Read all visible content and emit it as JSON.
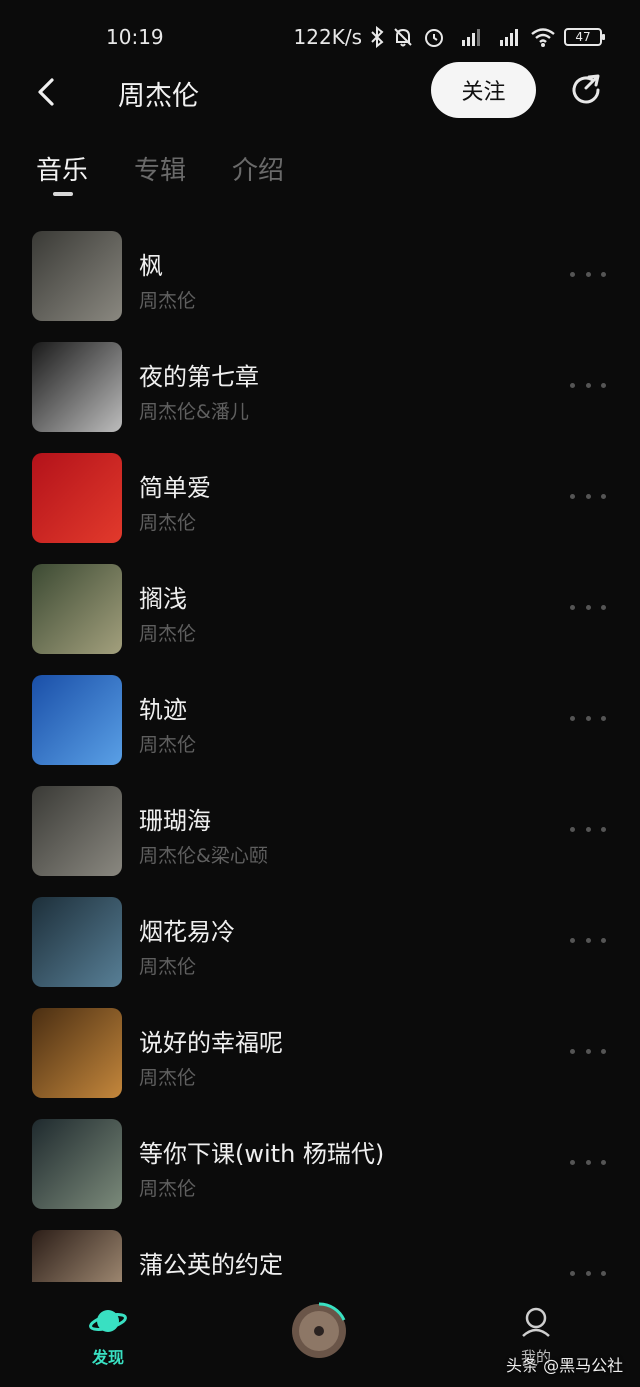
{
  "status_bar": {
    "time": "10:19",
    "speed": "122K/s",
    "battery": "47",
    "icons": [
      "bluetooth-icon",
      "bell-off-icon",
      "alarm-icon",
      "signal-hd-icon",
      "signal-hd-icon",
      "wifi-icon",
      "battery-icon"
    ]
  },
  "header": {
    "title": "周杰伦",
    "follow_label": "关注",
    "back_icon": "back-arrow-icon",
    "share_icon": "share-icon"
  },
  "tabs": [
    {
      "label": "音乐",
      "active": true
    },
    {
      "label": "专辑",
      "active": false
    },
    {
      "label": "介绍",
      "active": false
    }
  ],
  "songs": [
    {
      "title": "枫",
      "artist": "周杰伦",
      "cover": [
        "#3a3a36",
        "#8a8880"
      ]
    },
    {
      "title": "夜的第七章",
      "artist": "周杰伦&潘儿",
      "cover": [
        "#1a1a1a",
        "#bdbdbd"
      ]
    },
    {
      "title": "简单爱",
      "artist": "周杰伦",
      "cover": [
        "#b3121a",
        "#e23a2c"
      ]
    },
    {
      "title": "搁浅",
      "artist": "周杰伦",
      "cover": [
        "#3c4a33",
        "#a3a07d"
      ]
    },
    {
      "title": "轨迹",
      "artist": "周杰伦",
      "cover": [
        "#1a4fa8",
        "#5aa0e6"
      ]
    },
    {
      "title": "珊瑚海",
      "artist": "周杰伦&梁心颐",
      "cover": [
        "#3a3a36",
        "#8a8880"
      ]
    },
    {
      "title": "烟花易冷",
      "artist": "周杰伦",
      "cover": [
        "#1d2f3a",
        "#587f96"
      ]
    },
    {
      "title": "说好的幸福呢",
      "artist": "周杰伦",
      "cover": [
        "#4a2e12",
        "#c4873c"
      ]
    },
    {
      "title": "等你下课(with 杨瑞代)",
      "artist": "周杰伦",
      "cover": [
        "#1f2a2e",
        "#7b8a7a"
      ]
    },
    {
      "title": "蒲公英的约定",
      "artist": "",
      "cover": [
        "#2c1e18",
        "#b9a186"
      ]
    }
  ],
  "bottom_nav": {
    "discover_label": "发现",
    "mine_label": "我的"
  },
  "watermark": "头条 @黑马公社",
  "colors": {
    "accent": "#39e0c2",
    "background": "#0b0b0b"
  }
}
